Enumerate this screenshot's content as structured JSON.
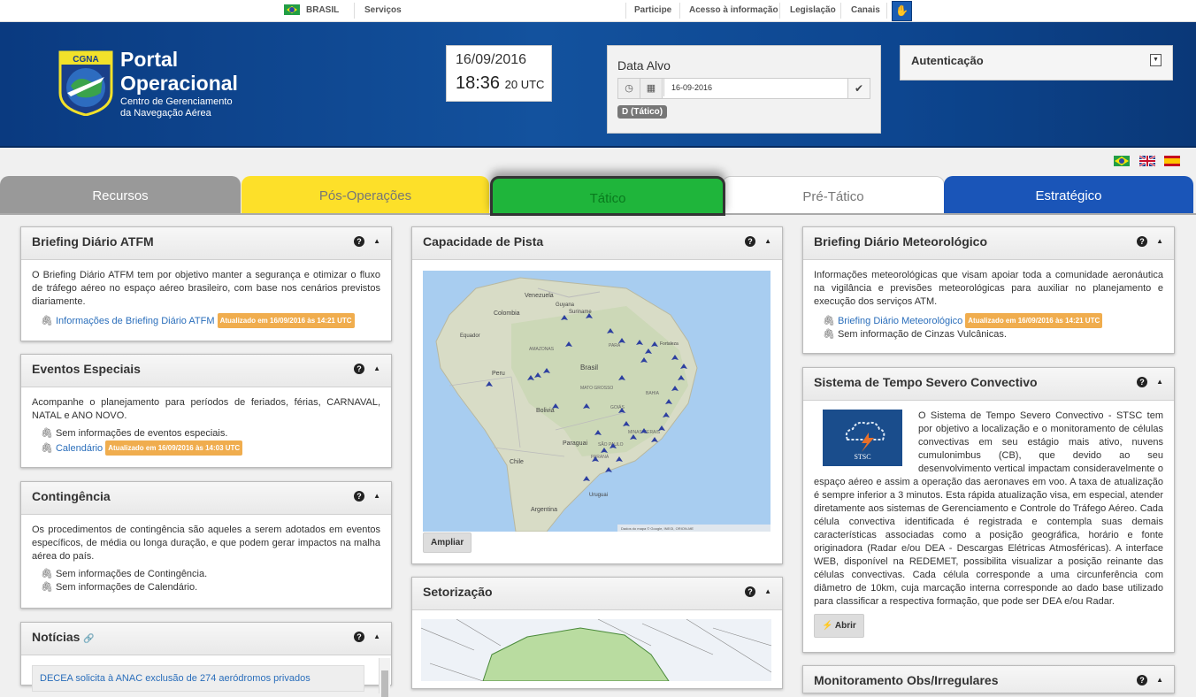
{
  "govbar": {
    "country": "BRASIL",
    "services": "Serviços",
    "links": [
      "Participe",
      "Acesso à informação",
      "Legislação",
      "Canais"
    ]
  },
  "header": {
    "logo_badge": "CGNA",
    "title_line1": "Portal",
    "title_line2": "Operacional",
    "subtitle_line1": "Centro de Gerenciamento",
    "subtitle_line2": "da Navegação Aérea"
  },
  "clock": {
    "date": "16/09/2016",
    "time": "18:36",
    "zone": "20 UTC"
  },
  "data_alvo": {
    "label": "Data Alvo",
    "value": "16-09-2016",
    "badge": "D (Tático)"
  },
  "auth": {
    "label": "Autenticação"
  },
  "tabs": [
    "Recursos",
    "Pós-Operações",
    "Tático",
    "Pré-Tático",
    "Estratégico"
  ],
  "panels": {
    "briefing_atfm": {
      "title": "Briefing Diário ATFM",
      "text": "O Briefing Diário ATFM tem por objetivo manter a segurança e otimizar o fluxo de tráfego aéreo no espaço aéreo brasileiro, com base nos cenários previstos diariamente.",
      "link": "Informações de Briefing Diário ATFM",
      "updated": "Atualizado em 16/09/2016 às 14:21 UTC"
    },
    "eventos": {
      "title": "Eventos Especiais",
      "text": "Acompanhe o planejamento para períodos de feriados, férias, CARNAVAL, NATAL e ANO NOVO.",
      "item1": "Sem informações de eventos especiais.",
      "link": "Calendário",
      "updated": "Atualizado em 16/09/2016 às 14:03 UTC"
    },
    "contingencia": {
      "title": "Contingência",
      "text": "Os procedimentos de contingência são aqueles a serem adotados em eventos específicos, de média ou longa duração, e que podem gerar impactos na malha aérea do país.",
      "item1": "Sem informações de Contingência.",
      "item2": "Sem informações de Calendário."
    },
    "noticias": {
      "title": "Notícias",
      "item": "DECEA solicita à ANAC exclusão de 274 aeródromos privados"
    },
    "capacidade": {
      "title": "Capacidade de Pista",
      "button": "Ampliar",
      "map_labels": [
        "Venezuela",
        "Colombia",
        "Guyana",
        "Suriname",
        "Equador",
        "Peru",
        "Brasil",
        "Bolivia",
        "Paraguai",
        "Chile",
        "Argentina",
        "Uruguai",
        "Fortaleza",
        "MATO GROSSO",
        "GOIÁS",
        "BAHIA",
        "PARÁ",
        "AMAZONAS",
        "MINAS GERAIS",
        "SÃO PAULO",
        "PARANÁ"
      ],
      "map_attrib": "Dados do mapa © Google, INEGI, ORION-ME"
    },
    "setorizacao": {
      "title": "Setorização"
    },
    "briefing_met": {
      "title": "Briefing Diário Meteorológico",
      "text": "Informações meteorológicas que visam apoiar toda a comunidade aeronáutica na vigilância e previsões meteorológicas para auxiliar no planejamento e execução dos serviços ATM.",
      "link": "Briefing Diário Meteorológico",
      "updated": "Atualizado em 16/09/2016 às 14:21 UTC",
      "item2": "Sem informação de Cinzas Vulcânicas."
    },
    "stsc": {
      "title": "Sistema de Tempo Severo Convectivo",
      "logo_text": "STSC",
      "text": "O Sistema de Tempo Severo Convectivo - STSC tem por objetivo a localização e o monitoramento de células convectivas em seu estágio mais ativo, nuvens cumulonimbus (CB), que devido ao seu desenvolvimento vertical impactam consideravelmente o espaço aéreo e assim a operação das aeronaves em voo. A taxa de atualização é sempre inferior a 3 minutos. Esta rápida atualização visa, em especial, atender diretamente aos sistemas de Gerenciamento e Controle do Tráfego Aéreo. Cada célula convectiva identificada é registrada e contempla suas demais características associadas como a posição geográfica, horário e fonte originadora (Radar e/ou DEA - Descargas Elétricas Atmosféricas). A interface WEB, disponível na REDEMET, possibilita visualizar a posição reinante das células convectivas. Cada célula corresponde a uma circunferência com diâmetro de 10km, cuja marcação interna corresponde ao dado base utilizado para classificar a respectiva formação, que pode ser DEA e/ou Radar.",
      "button": "Abrir"
    },
    "monitoramento": {
      "title": "Monitoramento Obs/Irregulares"
    }
  },
  "colors": {
    "header": "#13529e",
    "tatico": "#1fb53b",
    "pos": "#fde029",
    "estr": "#1a55b8",
    "recursos": "#999999"
  }
}
